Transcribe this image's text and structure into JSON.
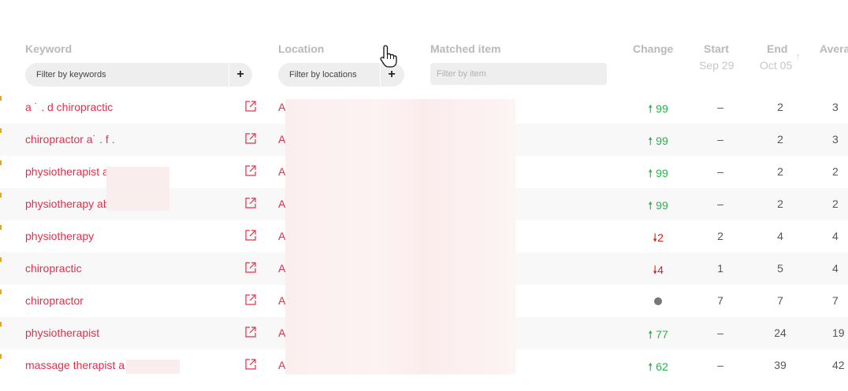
{
  "columns": {
    "keyword": "Keyword",
    "location": "Location",
    "matched_item": "Matched item",
    "change": "Change",
    "start": "Start",
    "start_date": "Sep 29",
    "end": "End",
    "end_date": "Oct 05",
    "average": "Avera"
  },
  "filters": {
    "keywords_placeholder": "Filter by keywords",
    "locations_placeholder": "Filter by locations",
    "item_placeholder": "Filter by item",
    "add_label": "+"
  },
  "sort_icon": "arrow-up-icon",
  "colors": {
    "keyword_link": "#e0304c",
    "change_up": "#27b34c",
    "change_down": "#e02020",
    "row_alt_bg": "#f8f8f8",
    "indicator": "#f0a020"
  },
  "rows": [
    {
      "keyword": "a[redacted]d chiropractic",
      "keyword_visible": "a  ˙ .   d chiropractic",
      "location": "A",
      "change_dir": "up",
      "change": "99",
      "start": "–",
      "end": "2",
      "avg": "3"
    },
    {
      "keyword": "chiropractor a[redacted]",
      "keyword_visible": "chiropractor a˙  .  f  .",
      "location": "A",
      "change_dir": "up",
      "change": "99",
      "start": "–",
      "end": "2",
      "avg": "3"
    },
    {
      "keyword": "physiotherapist a[redacted]",
      "keyword_visible": "physiotherapist a",
      "location": "A",
      "change_dir": "up",
      "change": "99",
      "start": "–",
      "end": "2",
      "avg": "2"
    },
    {
      "keyword": "physiotherapy ab[redacted]",
      "keyword_visible": "physiotherapy ab",
      "location": "A",
      "change_dir": "up",
      "change": "99",
      "start": "–",
      "end": "2",
      "avg": "2"
    },
    {
      "keyword": "physiotherapy",
      "keyword_visible": "physiotherapy",
      "location": "A",
      "change_dir": "down",
      "change": "2",
      "start": "2",
      "end": "4",
      "avg": "4"
    },
    {
      "keyword": "chiropractic",
      "keyword_visible": "chiropractic",
      "location": "A",
      "change_dir": "down",
      "change": "4",
      "start": "1",
      "end": "5",
      "avg": "4"
    },
    {
      "keyword": "chiropractor",
      "keyword_visible": "chiropractor",
      "location": "A",
      "change_dir": "none",
      "change": "",
      "start": "7",
      "end": "7",
      "avg": "7"
    },
    {
      "keyword": "physiotherapist",
      "keyword_visible": "physiotherapist",
      "location": "A",
      "change_dir": "up",
      "change": "77",
      "start": "–",
      "end": "24",
      "avg": "19"
    },
    {
      "keyword": "massage therapist a[redacted]",
      "keyword_visible": "massage therapist a",
      "location": "A",
      "change_dir": "up",
      "change": "62",
      "start": "–",
      "end": "39",
      "avg": "42"
    }
  ]
}
